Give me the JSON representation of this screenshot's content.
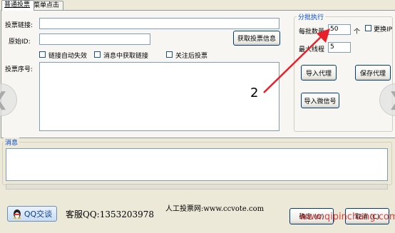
{
  "tabs": [
    {
      "label": "普通投票"
    },
    {
      "label": "菜单点击"
    }
  ],
  "left": {
    "vote_link_label": "投票链接:",
    "vote_link_value": "",
    "source_id_label": "原始ID:",
    "source_id_value": "",
    "get_info_button": "获取投票信息",
    "check_link_fail": "链接自动失效",
    "check_get_link": "消息中获取链接",
    "check_follow": "关注后投票",
    "vote_seq_label": "投票序号:"
  },
  "batch": {
    "group_title": "分批执行",
    "per_batch_label": "每批数量",
    "per_batch_value": "50",
    "unit": "个",
    "change_ip_label": "更换IP",
    "max_threads_label": "最大线程",
    "max_threads_value": "5",
    "import_proxy_button": "导入代理",
    "save_proxy_button": "保存代理",
    "import_wechat_button": "导入微信号"
  },
  "annotation_number": "2",
  "message": {
    "title": "消息",
    "content": ""
  },
  "footer": {
    "qq_button": "QQ交谈",
    "service": "客服QQ:1353203978",
    "site": "人工投票网:www.ccvote.com",
    "confirm_button": "确定 (O)",
    "cancel_button": "取消 (C)",
    "watermark": "www.qipinchang.com"
  },
  "colors": {
    "annotation": "#E8202A",
    "group_title": "#0046D5",
    "watermark": "#D32020"
  }
}
